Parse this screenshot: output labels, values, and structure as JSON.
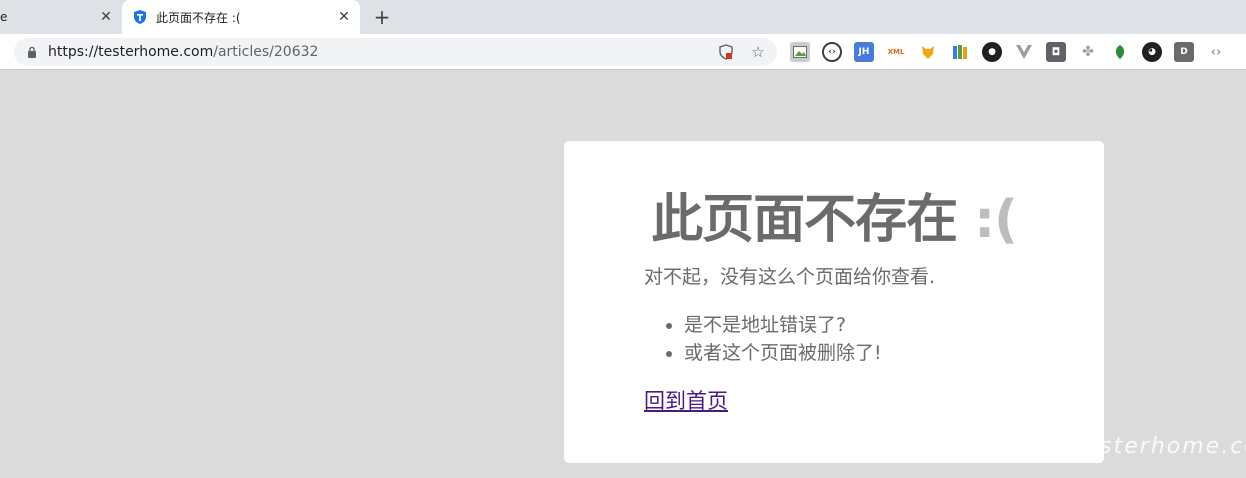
{
  "tabs": [
    {
      "label": "e",
      "active": false
    },
    {
      "label": "此页面不存在 :(",
      "active": true
    }
  ],
  "omnibox": {
    "host": "https://testerhome.com",
    "path": "/articles/20632"
  },
  "extensions": [
    {
      "name": "image-icon",
      "color": "#9aa0a6",
      "glyph": ""
    },
    {
      "name": "code-circle-icon",
      "color": "#3c4043",
      "glyph": ""
    },
    {
      "name": "jh-icon",
      "color": "#4a7bd9",
      "glyph": "JH"
    },
    {
      "name": "xml-icon",
      "color": "#e06a1b",
      "glyph": "XML"
    },
    {
      "name": "fox-icon",
      "color": "#f0a61b",
      "glyph": ""
    },
    {
      "name": "books-icon",
      "color": "#5a9e3a",
      "glyph": ""
    },
    {
      "name": "cat-icon",
      "color": "#202124",
      "glyph": ""
    },
    {
      "name": "vue-icon",
      "color": "#8a8a8a",
      "glyph": ""
    },
    {
      "name": "camera-icon",
      "color": "#5f6368",
      "glyph": ""
    },
    {
      "name": "puzzle-icon",
      "color": "#9aa0a6",
      "glyph": ""
    },
    {
      "name": "leaf-icon",
      "color": "#2e8b3a",
      "glyph": ""
    },
    {
      "name": "github-icon",
      "color": "#202124",
      "glyph": ""
    },
    {
      "name": "d-icon",
      "color": "#6b6b6b",
      "glyph": "D"
    },
    {
      "name": "angle-brackets-icon",
      "color": "#9aa0a6",
      "glyph": ""
    }
  ],
  "page": {
    "heading": "此页面不存在",
    "face": ":(",
    "sorry": "对不起，没有这么个页面给你查看.",
    "reasons": [
      "是不是地址错误了?",
      "或者这个页面被删除了!"
    ],
    "home_link": "回到首页"
  },
  "watermark": "testerhome.com"
}
